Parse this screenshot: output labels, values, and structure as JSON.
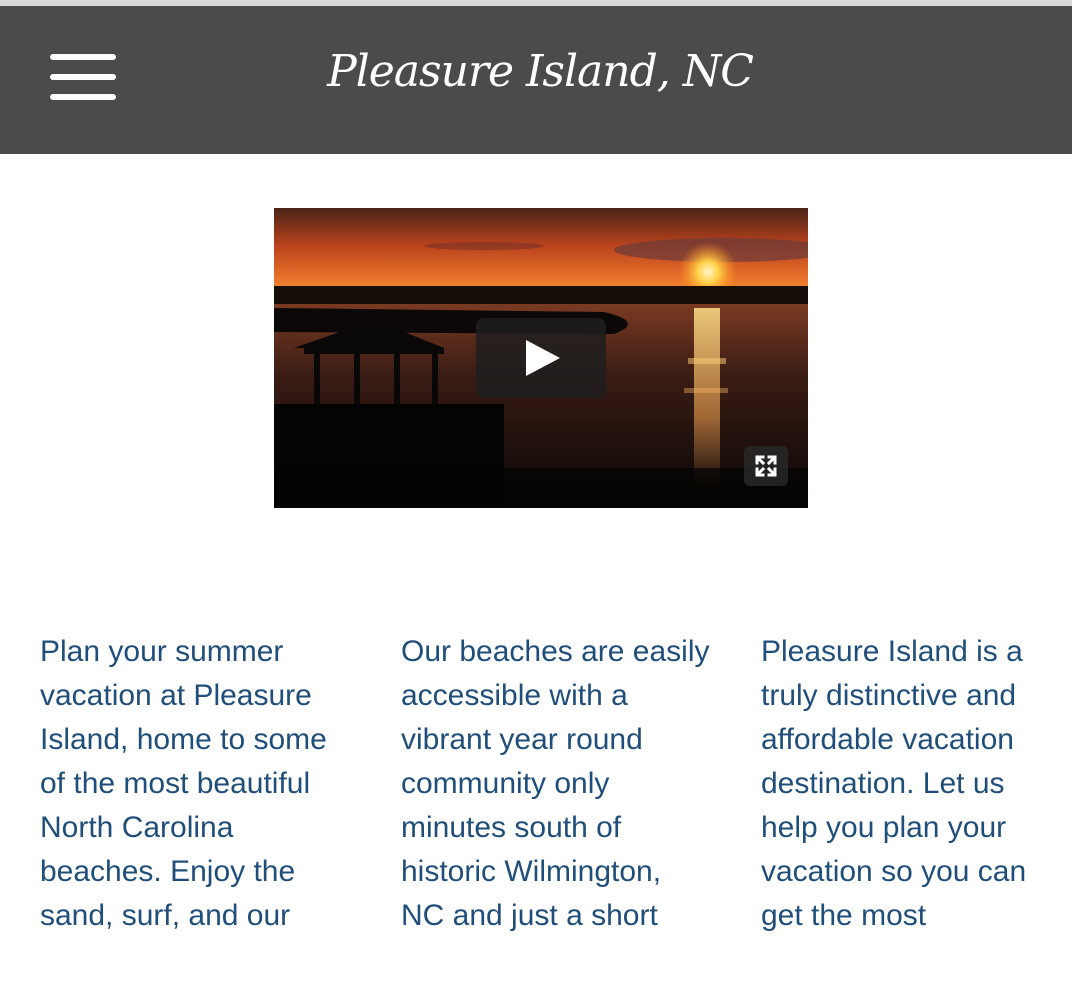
{
  "header": {
    "title": "Pleasure Island, NC",
    "menu_icon": "hamburger-menu-icon",
    "background": "#4b4b4b"
  },
  "video": {
    "play_icon": "play-icon",
    "fullscreen_icon": "fullscreen-icon"
  },
  "columns": [
    "Plan your summer vacation at Pleasure Island, home to some of the most beautiful North Carolina beaches. Enjoy the sand, surf, and our",
    "Our beaches are easily accessible with a vibrant year round community only minutes south of historic Wilmington, NC and just a short",
    "Pleasure Island is a truly distinctive and affordable vacation destination. Let us help you plan your vacation so you can get the most"
  ],
  "colors": {
    "text": "#1f4e7a",
    "header_bg": "#4b4b4b"
  }
}
